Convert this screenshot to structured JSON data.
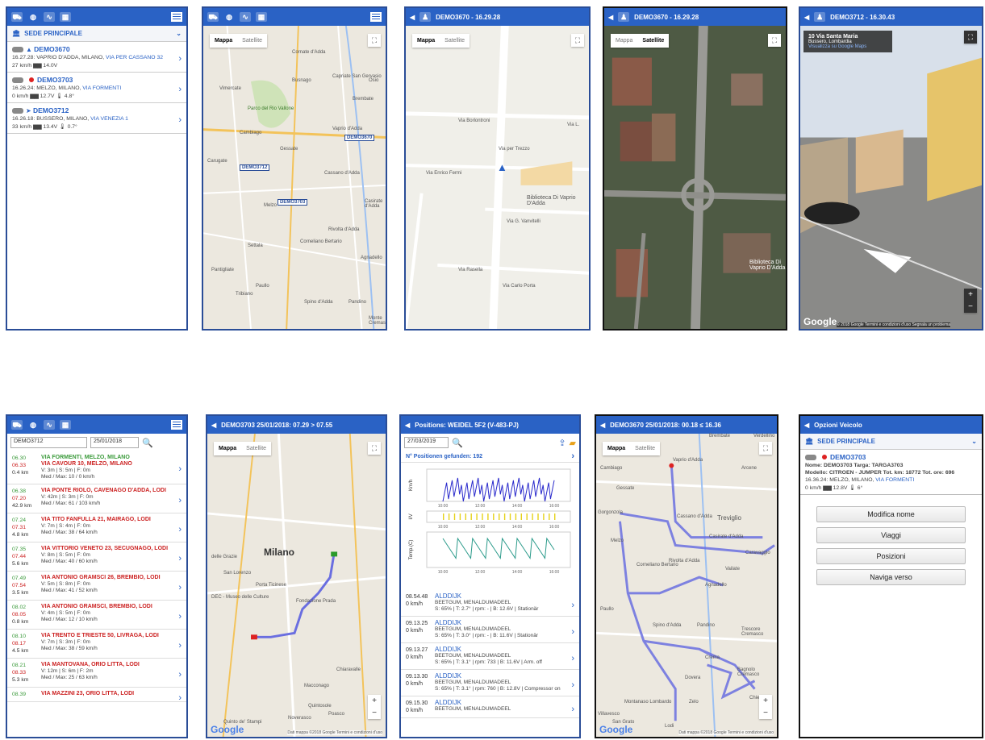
{
  "colors": {
    "brand": "#2a62c5",
    "route": "#6a6ee0",
    "green": "#3a9a3a",
    "red": "#c22222"
  },
  "p1": {
    "sede": "SEDE PRINCIPALE",
    "vehicles": [
      {
        "name": "DEMO3670",
        "line1": "16.27.28: VAPRIO D'ADDA, MILANO, ",
        "link": "VIA PER CASSANO 32",
        "line2": "27 km/h  ▆▆ 14.0V"
      },
      {
        "name": "DEMO3703",
        "line1": "16.26.24: MELZO, MILANO, ",
        "link": "VIA FORMENTI",
        "line2": "0 km/h  ▆▆ 12.7V  🌡 4.8°"
      },
      {
        "name": "DEMO3712",
        "line1": "16.26.18: BUSSERO, MILANO, ",
        "link": "VIA VENEZIA 1",
        "line2": "33 km/h  ▆▆ 13.4V  🌡 0.7°"
      }
    ]
  },
  "p2": {
    "tab_map": "Mappa",
    "tab_sat": "Satellite",
    "labels": [
      "Cornate d'Adda",
      "Vimercate",
      "Busnago",
      "Capriate San Gervasio",
      "Osio",
      "Parco del Rio Vallone",
      "Brembate",
      "Vaprio d'Adda",
      "Cambiago",
      "Gessate",
      "Carugate",
      "Cassano d'Adda",
      "Melzo",
      "Casirate d'Adda",
      "Rivolta d'Adda",
      "Corneliano Bertario",
      "Settala",
      "Agnadello",
      "Pantigliate",
      "Paullo",
      "Tribiano",
      "Spino d'Adda",
      "Pandino",
      "Monte Cremasc"
    ],
    "tags": [
      "DEMO3670",
      "DEMO3712",
      "DEMO3703"
    ]
  },
  "p3": {
    "title": "DEMO3670 - 16.29.28",
    "tab_map": "Mappa",
    "tab_sat": "Satellite",
    "streets": [
      "Via Borlontroni",
      "Via G. Vanvitelli",
      "Via Rasella",
      "Via Enrico Fermi",
      "Via per Trezzo",
      "Via Carlo Porta",
      "Biblioteca Di Vaprio D'Adda",
      "Via L."
    ]
  },
  "p4": {
    "title": "DEMO3670 - 16.29.28",
    "tab_map": "Mappa",
    "tab_sat": "Satellite",
    "place": "Biblioteca Di Vaprio D'Adda"
  },
  "p5": {
    "title": "DEMO3712 - 16.30.43",
    "addr": "10 Via Santa Maria",
    "city": "Bussero, Lombardia",
    "link": "Visualizza su Google Maps",
    "footer": "© 2018 Google   Termini e condizioni d'uso   Segnala un problema"
  },
  "p6": {
    "vehicle": "DEMO3712",
    "date": "25/01/2018",
    "trips": [
      {
        "t1": "06.30",
        "t2": "06.33",
        "km": "0.4 km",
        "a": "VIA FORMENTI, MELZO, MILANO",
        "b": "VIA CAVOUR 10, MELZO, MILANO",
        "s": "V: 3m | S: 5m | F: 0m",
        "m": "Med / Max: 10 / 0 km/h"
      },
      {
        "t1": "06.38",
        "t2": "07.20",
        "km": "42.9 km",
        "a": "",
        "b": "VIA PONTE RIOLO, CAVENAGO D'ADDA, LODI",
        "s": "V: 42m | S: 3m | F: 0m",
        "m": "Med / Max: 61 / 103 km/h"
      },
      {
        "t1": "07.24",
        "t2": "07.31",
        "km": "4.8 km",
        "a": "",
        "b": "VIA TITO FANFULLA 21, MAIRAGO, LODI",
        "s": "V: 7m | S: 4m | F: 0m",
        "m": "Med / Max: 38 / 64 km/h"
      },
      {
        "t1": "07.35",
        "t2": "07.44",
        "km": "5.6 km",
        "a": "",
        "b": "VIA VITTORIO VENETO 23, SECUGNAGO, LODI",
        "s": "V: 8m | S: 5m | F: 0m",
        "m": "Med / Max: 40 / 60 km/h"
      },
      {
        "t1": "07.49",
        "t2": "07.54",
        "km": "3.5 km",
        "a": "",
        "b": "VIA ANTONIO GRAMSCI 26, BREMBIO, LODI",
        "s": "V: 5m | S: 8m | F: 0m",
        "m": "Med / Max: 41 / 52 km/h"
      },
      {
        "t1": "08.02",
        "t2": "08.05",
        "km": "0.8 km",
        "a": "",
        "b": "VIA ANTONIO GRAMSCI, BREMBIO, LODI",
        "s": "V: 4m | S: 5m | F: 0m",
        "m": "Med / Max: 12 / 10 km/h"
      },
      {
        "t1": "08.10",
        "t2": "08.17",
        "km": "4.5 km",
        "a": "",
        "b": "VIA TRENTO E TRIESTE 50, LIVRAGA, LODI",
        "s": "V: 7m | S: 3m | F: 0m",
        "m": "Med / Max: 38 / 59 km/h"
      },
      {
        "t1": "08.21",
        "t2": "08.33",
        "km": "5.3 km",
        "a": "",
        "b": "VIA MANTOVANA, ORIO LITTA, LODI",
        "s": "V: 12m | S: 6m | F: 2m",
        "m": "Med / Max: 25 / 63 km/h"
      },
      {
        "t1": "08.39",
        "t2": "",
        "km": "",
        "a": "",
        "b": "VIA MAZZINI 23, ORIO LITTA, LODI",
        "s": "",
        "m": ""
      }
    ]
  },
  "p7": {
    "title": "DEMO3703 25/01/2018: 07.29 > 07.55",
    "tab_map": "Mappa",
    "tab_sat": "Satellite",
    "city": "Milano",
    "places": [
      "Porta Ticinese",
      "Fondazione Prada",
      "Chiaravalle",
      "Macconago",
      "Quintosole",
      "Noverasco",
      "Poasco",
      "Quinto de' Stampi",
      "San Lorenzo",
      "delle Grazie",
      "DEC - Museo delle Culture"
    ],
    "attr": "Dati mappa ©2018 Google   Termini e condizioni d'uso"
  },
  "p8": {
    "title": "Positions: WEIDEL 5F2 (V-483-PJ)",
    "date": "27/03/2019",
    "found": "N° Positionen gefunden: 192",
    "axis1": "Km/h",
    "axis2": "I/V",
    "axis3": "Temp.(C)",
    "ticks": [
      "10:00",
      "12:00",
      "14:00",
      "16:00"
    ],
    "rows": [
      {
        "t": "08.54.48",
        "s": "0 km/h",
        "a": "ALDDIJK",
        "b": "BEETGUM, MENALDUMADEEL",
        "c": "S: 65% | T: 2.7° | rpm: - | B: 12.6V | Stationär"
      },
      {
        "t": "09.13.25",
        "s": "0 km/h",
        "a": "ALDDIJK",
        "b": "BEETGUM, MENALDUMADEEL",
        "c": "S: 65% | T: 3.0° | rpm: - | B: 11.6V | Stationär"
      },
      {
        "t": "09.13.27",
        "s": "0 km/h",
        "a": "ALDDIJK",
        "b": "BEETGUM, MENALDUMADEEL",
        "c": "S: 65% | T: 3.1° | rpm: 733 | B: 11.6V | Arm. off"
      },
      {
        "t": "09.13.30",
        "s": "0 km/h",
        "a": "ALDDIJK",
        "b": "BEETGUM, MENALDUMADEEL",
        "c": "S: 65% | T: 3.1° | rpm: 760 | B: 12.8V | Compressor on"
      },
      {
        "t": "09.15.30",
        "s": "0 km/h",
        "a": "ALDDIJK",
        "b": "BEETGUM, MENALDUMADEEL",
        "c": ""
      }
    ]
  },
  "p9": {
    "title": "DEMO3670 25/01/2018: 00.18 ≤ 16.36",
    "tab_map": "Mappa",
    "tab_sat": "Satellite",
    "places": [
      "Brembate",
      "Verdellino",
      "Vaprio d'Adda",
      "Arcene",
      "Cambiago",
      "Gessate",
      "Treviglio",
      "Cassano d'Adda",
      "Casirate d'Adda",
      "Caravaggio",
      "Melzo",
      "Rivolta d'Adda",
      "Corneliano Bertario",
      "Vailate",
      "Agnadello",
      "Paullo",
      "Spino d'Adda",
      "Pandino",
      "Trescore Cremasco",
      "Crema",
      "Dovera",
      "Bagnolo Cremasco",
      "Montanaso Lombardo",
      "San Grato",
      "Chieve",
      "Lodi",
      "Zelo",
      "Gorgonzola",
      "Villavesco"
    ],
    "attr": "Dati mappa ©2018 Google   Termini e condizioni d'uso"
  },
  "p10": {
    "title": "Opzioni Veicolo",
    "sede": "SEDE PRINCIPALE",
    "name": "DEMO3703",
    "l1": "Nome: DEMO3703   Targa: TARGA3703",
    "l2": "Modello: CITROEN - JUMPER   Tot. km: 18772   Tot. ore: 696",
    "l3": "16.36.24: MELZO, MILANO, ",
    "link": "VIA FORMENTI",
    "l4": "0 km/h  ▆▆ 12.8V  🌡 6°",
    "buttons": [
      "Modifica nome",
      "Viaggi",
      "Posizioni",
      "Naviga verso"
    ]
  },
  "chart_data": {
    "type": "line",
    "title": "",
    "x": [
      "10:00",
      "12:00",
      "14:00",
      "16:00"
    ],
    "series": [
      {
        "name": "Km/h",
        "values": [
          40,
          90,
          70,
          80
        ]
      },
      {
        "name": "I/V",
        "values": [
          1,
          1,
          1,
          1
        ]
      },
      {
        "name": "Temp.(C)",
        "values": [
          2,
          6,
          4,
          5
        ]
      }
    ]
  }
}
